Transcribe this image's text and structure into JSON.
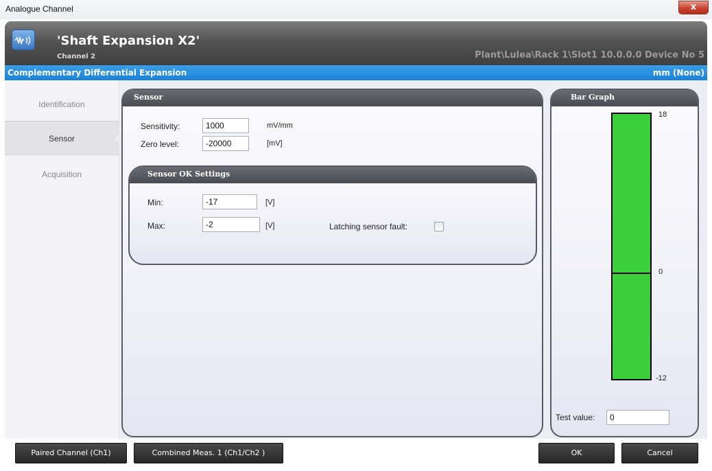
{
  "window": {
    "title": "Analogue Channel",
    "close_label": "x"
  },
  "header": {
    "title": "'Shaft Expansion X2'",
    "subtitle": "Channel 2",
    "path": "Plant\\Lulea\\Rack 1\\Slot1 10.0.0.0 Device No 5",
    "logo_icon": "waveform-icon"
  },
  "blue_bar": {
    "left": "Complementary Differential Expansion",
    "right": "mm (None)"
  },
  "nav": {
    "items": [
      {
        "label": "Identification",
        "active": false
      },
      {
        "label": "Sensor",
        "active": true
      },
      {
        "label": "Acquisition",
        "active": false
      }
    ]
  },
  "sensor_panel": {
    "title": "Sensor",
    "sensitivity_label": "Sensitivity:",
    "sensitivity_value": "1000",
    "sensitivity_unit": "mV/mm",
    "zero_label": "Zero level:",
    "zero_value": "-20000",
    "zero_unit": "[mV]"
  },
  "ok_settings": {
    "title": "Sensor OK Settings",
    "min_label": "Min:",
    "min_value": "-17",
    "min_unit": "[V]",
    "max_label": "Max:",
    "max_value": "-2",
    "max_unit": "[V]",
    "latching_label": "Latching sensor fault:",
    "latching_checked": false
  },
  "bar_graph": {
    "title": "Bar Graph",
    "max_label": "18",
    "zero_label": "0",
    "min_label": "-12",
    "max": 18,
    "min": -12,
    "bar_color": "#3ccf3c",
    "test_label": "Test value:",
    "test_value": "0"
  },
  "buttons": {
    "paired": "Paired Channel (Ch1)",
    "combined": "Combined Meas. 1 (Ch1/Ch2 )",
    "ok": "OK",
    "cancel": "Cancel"
  }
}
